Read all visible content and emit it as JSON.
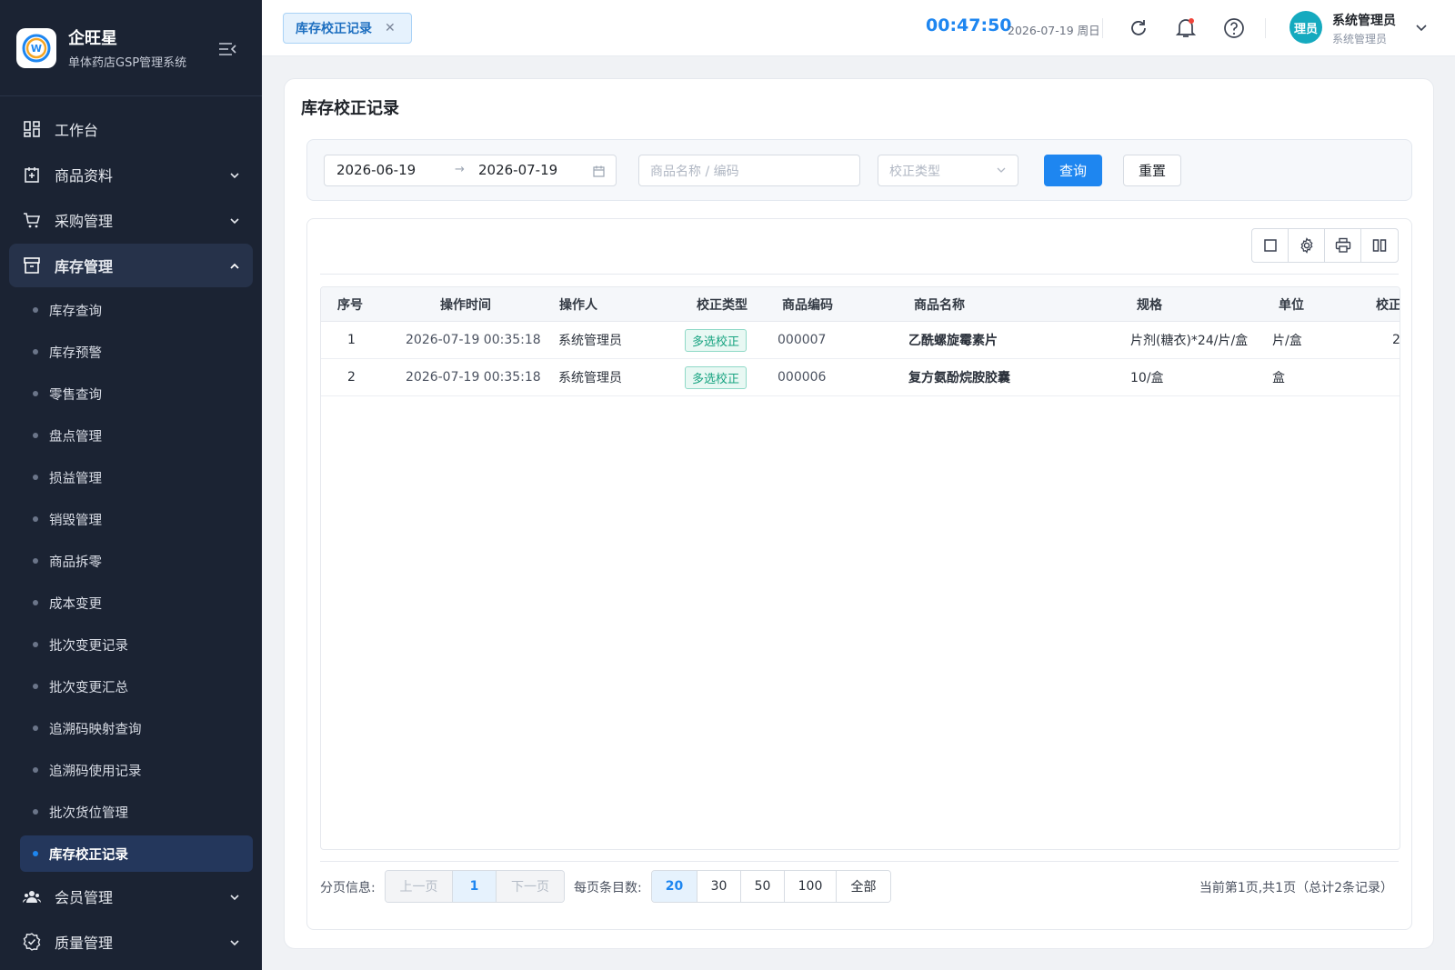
{
  "brand": {
    "name": "企旺星",
    "subtitle": "单体药店GSP管理系统"
  },
  "nav": {
    "items": [
      {
        "label": "工作台",
        "icon": "dashboard-icon"
      },
      {
        "label": "商品资料",
        "icon": "goods-icon"
      },
      {
        "label": "采购管理",
        "icon": "cart-icon"
      },
      {
        "label": "库存管理",
        "icon": "inventory-icon"
      }
    ],
    "inventory_sub": [
      "库存查询",
      "库存预警",
      "零售查询",
      "盘点管理",
      "损益管理",
      "销毁管理",
      "商品拆零",
      "成本变更",
      "批次变更记录",
      "批次变更汇总",
      "追溯码映射查询",
      "追溯码使用记录",
      "批次货位管理",
      "库存校正记录"
    ],
    "after": [
      {
        "label": "会员管理",
        "icon": "members-icon"
      },
      {
        "label": "质量管理",
        "icon": "quality-icon"
      }
    ]
  },
  "topbar": {
    "tab_label": "库存校正记录",
    "time": "00:47:50",
    "date": "2026-07-19 周日",
    "avatar_text": "理员",
    "user_name": "系统管理员",
    "user_role": "系统管理员"
  },
  "page": {
    "title": "库存校正记录"
  },
  "filter": {
    "date_start": "2026-06-19",
    "date_end": "2026-07-19",
    "keyword_placeholder": "商品名称 / 编码",
    "type_placeholder": "校正类型",
    "query_label": "查询",
    "reset_label": "重置"
  },
  "table": {
    "columns": [
      "序号",
      "操作时间",
      "操作人",
      "校正类型",
      "商品编码",
      "商品名称",
      "规格",
      "单位",
      "校正"
    ],
    "rows": [
      {
        "no": "1",
        "time": "2026-07-19 00:35:18",
        "operator": "系统管理员",
        "type": "多选校正",
        "code": "000007",
        "name": "乙酰螺旋霉素片",
        "spec": "片剂(糖衣)*24/片/盒",
        "unit": "片/盒",
        "extra": "2"
      },
      {
        "no": "2",
        "time": "2026-07-19 00:35:18",
        "operator": "系统管理员",
        "type": "多选校正",
        "code": "000006",
        "name": "复方氨酚烷胺胶囊",
        "spec": "10/盒",
        "unit": "盒",
        "extra": ""
      }
    ]
  },
  "pager": {
    "info_label": "分页信息:",
    "prev": "上一页",
    "current": "1",
    "next": "下一页",
    "size_label": "每页条目数:",
    "sizes": [
      "20",
      "30",
      "50",
      "100",
      "全部"
    ],
    "summary": "当前第1页,共1页（总计2条记录）"
  },
  "colors": {
    "primary": "#1e86f0",
    "sidebar": "#1b2333",
    "badge": "#17a380"
  }
}
